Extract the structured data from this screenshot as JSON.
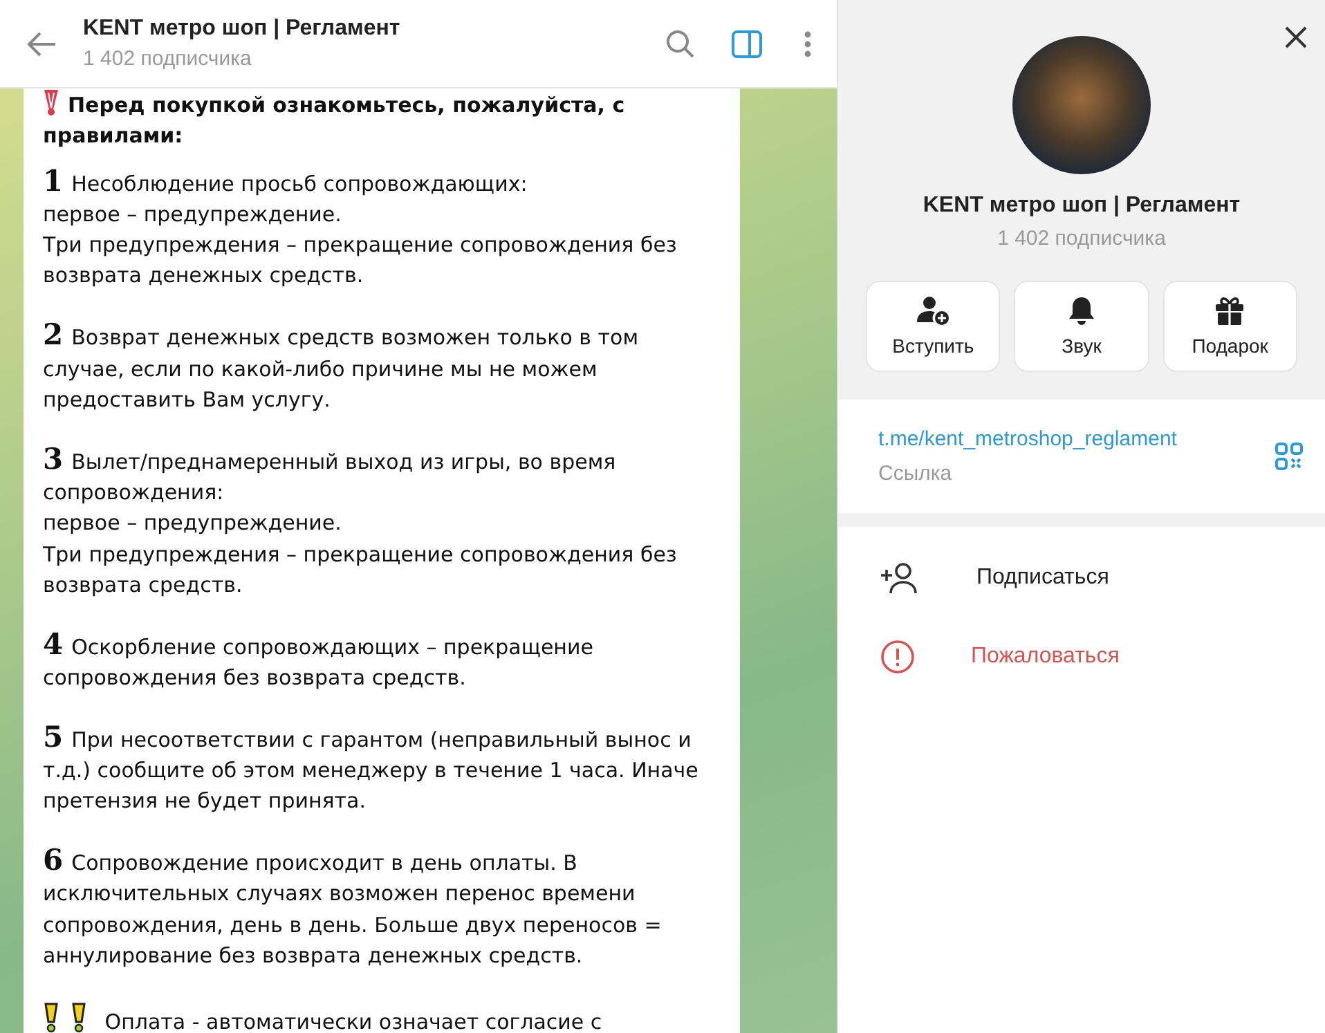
{
  "header": {
    "title": "KENT метро шоп | Регламент",
    "subtitle": "1 402 подписчика"
  },
  "message": {
    "heading": "Перед покупкой ознакомьтесь, пожалуйста, с правилами:",
    "rules": [
      {
        "marker": "1",
        "lines": [
          "Несоблюдение просьб сопровождающих:",
          "первое – предупреждение.",
          "Три предупреждения – прекращение сопровождения без возврата денежных средств."
        ]
      },
      {
        "marker": "2",
        "lines": [
          "Возврат денежных средств возможен только в том случае, если по какой-либо причине мы не можем предоставить Вам услугу."
        ]
      },
      {
        "marker": "3",
        "lines": [
          "Вылет/преднамеренный выход из игры, во время сопровождения:",
          "первое – предупреждение.",
          "Три предупреждения – прекращение сопровождения без возврата средств."
        ]
      },
      {
        "marker": "4",
        "lines": [
          "Оскорбление сопровождающих – прекращение сопровождения без возврата средств."
        ]
      },
      {
        "marker": "5",
        "lines": [
          "При несоответствии с гарантом (неправильный вынос и т.д.) сообщите об этом менеджеру в течение 1 часа. Иначе претензия не будет принята."
        ]
      },
      {
        "marker": "6",
        "lines": [
          "Сопровождение происходит в день оплаты. В исключительных случаях возможен перенос времени сопровождения, день в день. Больше двух переносов = аннулирование без возврата денежных средств."
        ]
      }
    ],
    "footer_line": "Оплата - автоматически означает согласие с"
  },
  "profile": {
    "name": "KENT метро шоп | Регламент",
    "subtitle": "1 402 подписчика",
    "actions": [
      {
        "kind": "join",
        "label": "Вступить"
      },
      {
        "kind": "sound",
        "label": "Звук"
      },
      {
        "kind": "gift",
        "label": "Подарок"
      }
    ],
    "link": {
      "url": "t.me/kent_metroshop_reglament",
      "caption": "Ссылка"
    },
    "menu": [
      {
        "kind": "subscribe",
        "label": "Подписаться"
      },
      {
        "kind": "report",
        "label": "Пожаловаться"
      }
    ]
  }
}
